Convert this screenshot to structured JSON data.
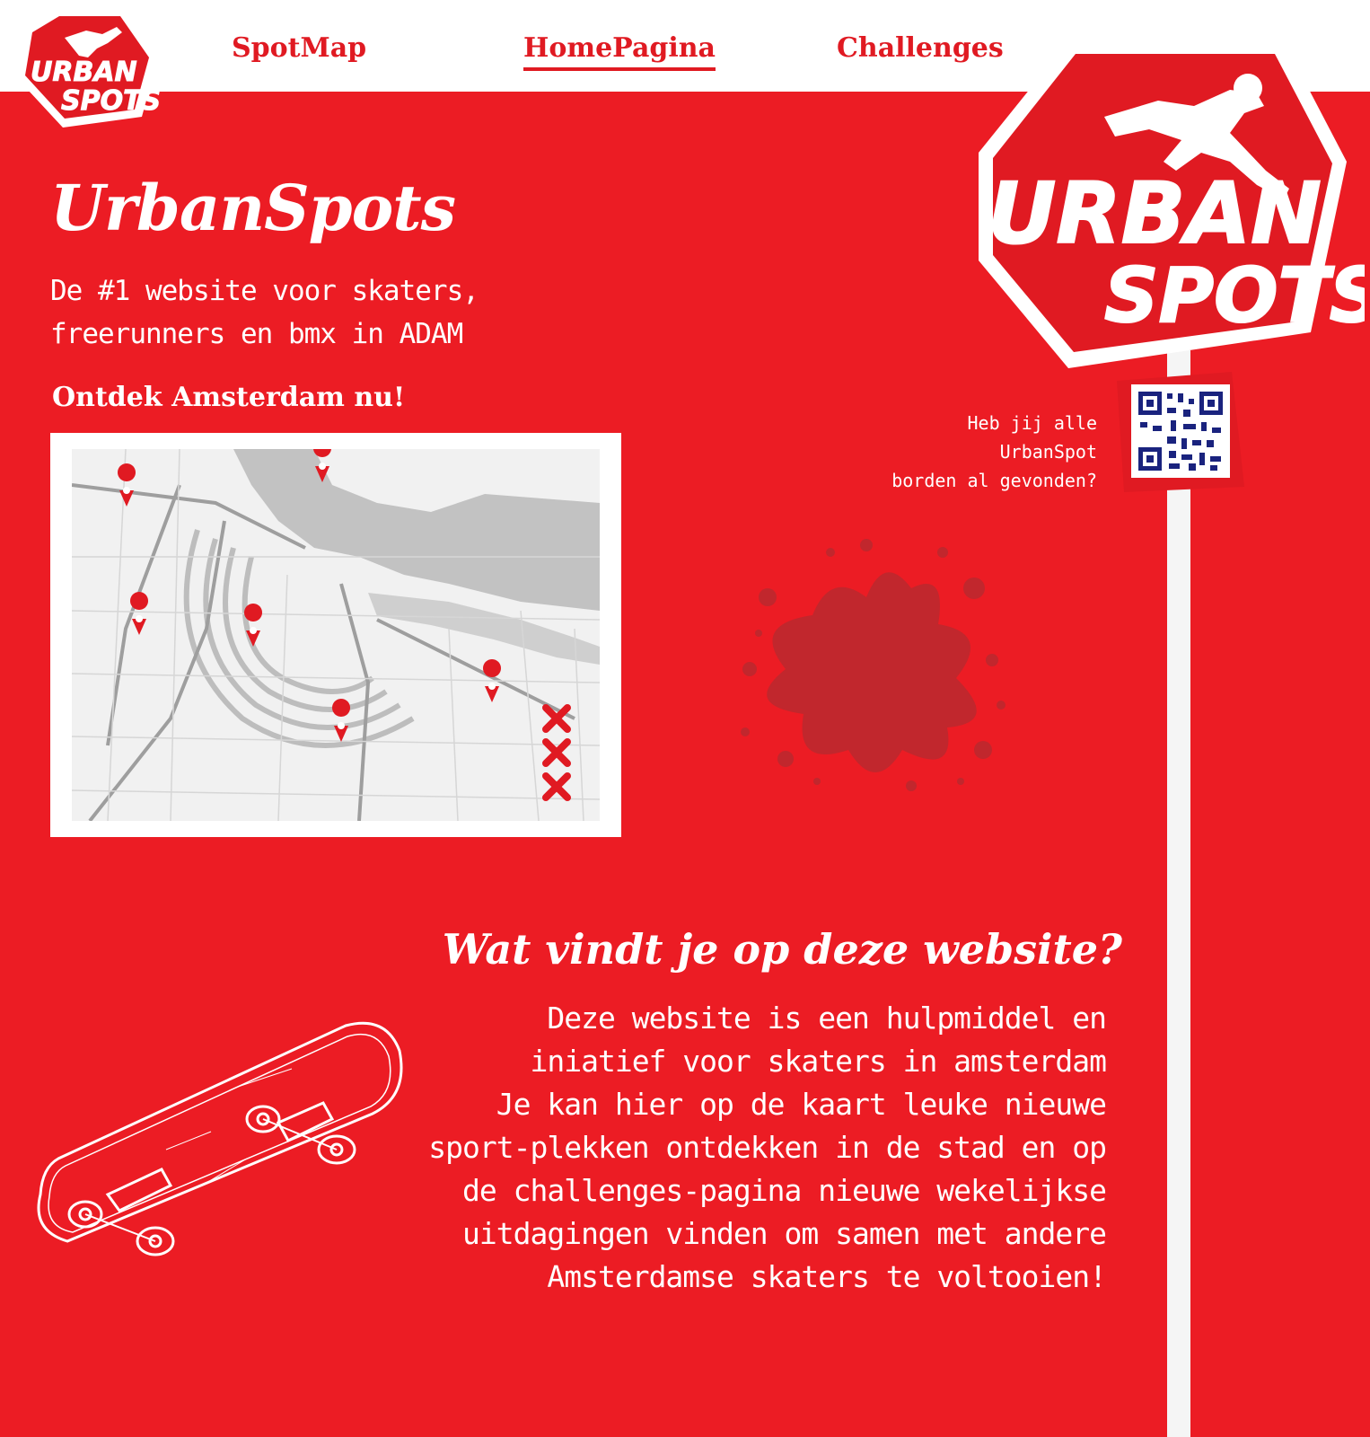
{
  "header": {
    "logo": {
      "line1": "URBAN",
      "line2": "SPOTS"
    },
    "nav": [
      {
        "label": "SpotMap",
        "active": false
      },
      {
        "label": "HomePagina",
        "active": true
      },
      {
        "label": "Challenges",
        "active": false
      }
    ]
  },
  "hero": {
    "title": "UrbanSpots",
    "subtitle": "De #1 website voor skaters, freerunners en bmx in ADAM",
    "explore": "Ontdek Amsterdam nu!"
  },
  "map": {
    "icon": "amsterdam-map",
    "pin_count": 6,
    "marker": "XXX"
  },
  "sign": {
    "line1": "URBAN",
    "line2": "SPOTS",
    "qr_icon": "qr-code"
  },
  "qr_prompt": {
    "line1": "Heb jij alle UrbanSpot",
    "line2": "borden al gevonden?"
  },
  "about": {
    "title": "Wat vindt je op deze website?",
    "paragraphs": [
      "Deze website is een hulpmiddel en iniatief voor skaters in amsterdam",
      "Je kan hier op de kaart leuke nieuwe sport-plekken ontdekken in de stad en op de challenges-pagina nieuwe wekelijkse uitdagingen vinden om samen met andere Amsterdamse skaters te voltooien!"
    ]
  },
  "colors": {
    "brand_red": "#ec1c24",
    "dark_red": "#c1272d",
    "white": "#ffffff",
    "qr_blue": "#1a237e"
  }
}
